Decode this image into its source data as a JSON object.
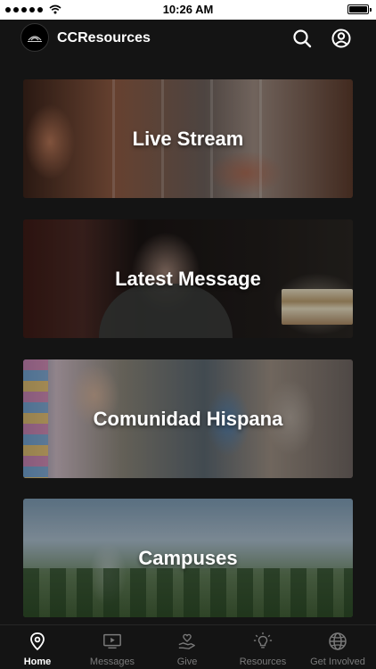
{
  "status_bar": {
    "time": "10:26 AM"
  },
  "header": {
    "app_title": "CCResources",
    "logo_icon": "church-logo-icon",
    "search_icon": "search-icon",
    "account_icon": "account-icon"
  },
  "cards": [
    {
      "label": "Live Stream"
    },
    {
      "label": "Latest Message"
    },
    {
      "label": "Comunidad Hispana"
    },
    {
      "label": "Campuses"
    }
  ],
  "tab_bar": {
    "active_tab": "Home",
    "tabs": [
      {
        "label": "Home",
        "icon": "location-pin-icon"
      },
      {
        "label": "Messages",
        "icon": "play-screen-icon"
      },
      {
        "label": "Give",
        "icon": "heart-hand-icon"
      },
      {
        "label": "Resources",
        "icon": "lightbulb-icon"
      },
      {
        "label": "Get Involved",
        "icon": "globe-icon"
      }
    ]
  },
  "colors": {
    "background": "#141414",
    "text_primary": "#ffffff",
    "tab_inactive": "#7a7a7a"
  }
}
